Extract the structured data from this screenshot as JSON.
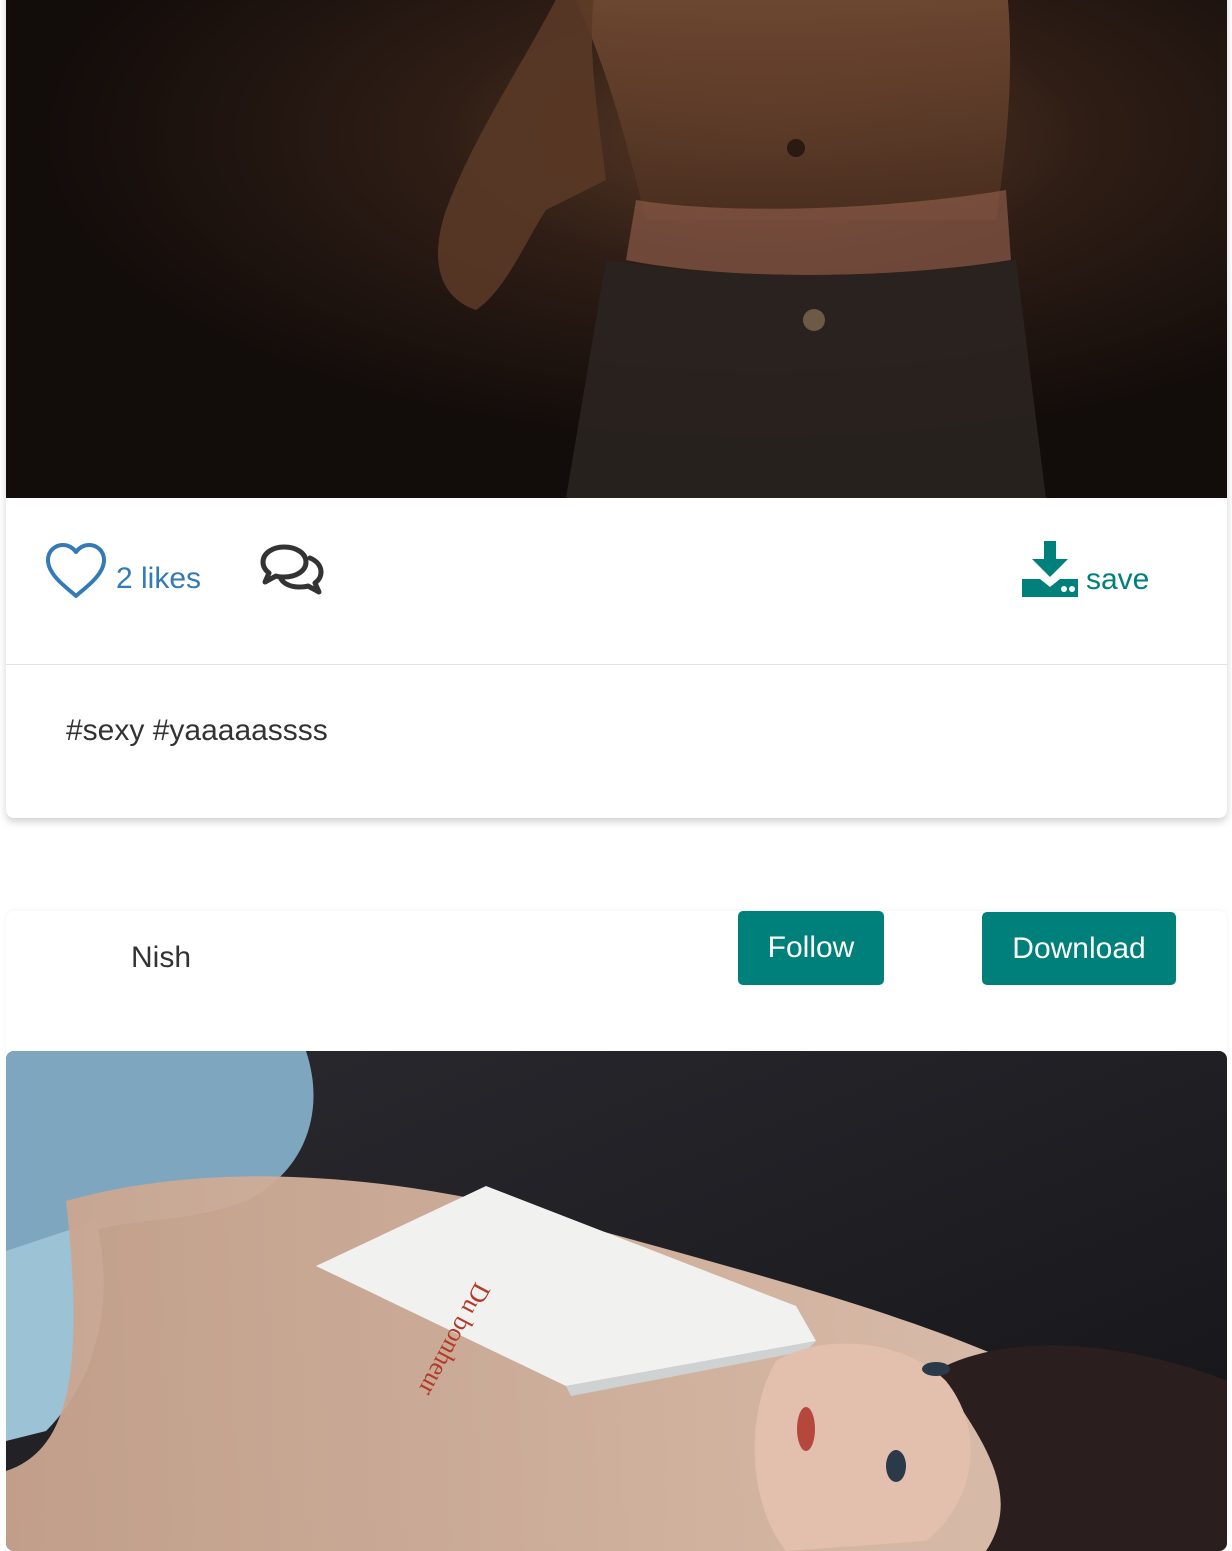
{
  "colors": {
    "accent": "#00807a",
    "like": "#337ab7",
    "text": "#333333",
    "divider": "#e3e3e3"
  },
  "post_1": {
    "photo_description_icon": "photo-placeholder",
    "likes_label": "2 likes",
    "like_icon": "heart-outline-icon",
    "comment_icon": "comments-icon",
    "save_icon": "download-drive-icon",
    "save_label": "save",
    "caption": "#sexy #yaaaaassss"
  },
  "post_2": {
    "username": "Nish",
    "follow_label": "Follow",
    "download_label": "Download",
    "photo_description_icon": "photo-placeholder"
  }
}
